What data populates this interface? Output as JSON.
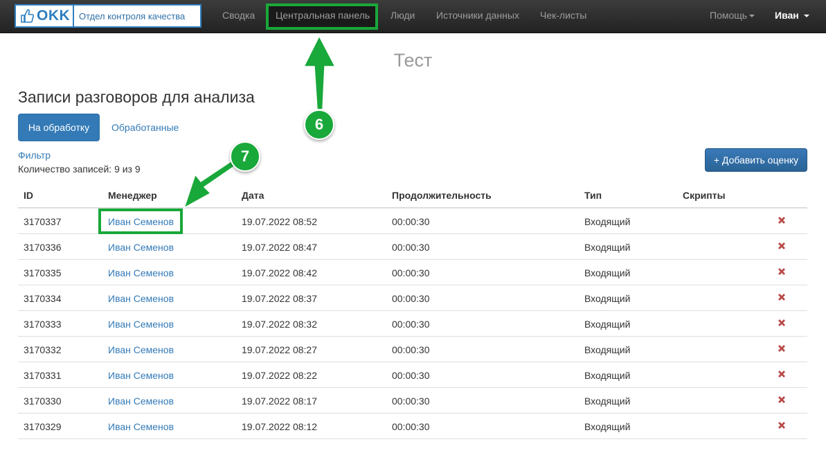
{
  "brand": {
    "logo_text": "OKK",
    "subtitle": "Отдел контроля качества"
  },
  "nav": {
    "items": [
      "Сводка",
      "Центральная панель",
      "Люди",
      "Источники данных",
      "Чек-листы"
    ],
    "help": "Помощь",
    "user": "Иван"
  },
  "page": {
    "title": "Тест",
    "section_title": "Записи разговоров для анализа",
    "tabs": {
      "active": "На обработку",
      "other": "Обработанные"
    },
    "filter": "Фильтр",
    "records_count": "Количество записей: 9 из 9",
    "add_button": "+ Добавить оценку"
  },
  "table": {
    "headers": [
      "ID",
      "Менеджер",
      "Дата",
      "Продолжительность",
      "Тип",
      "Скрипты"
    ],
    "rows": [
      {
        "id": "3170337",
        "manager": "Иван Семенов",
        "date": "19.07.2022 08:52",
        "duration": "00:00:30",
        "type": "Входящий"
      },
      {
        "id": "3170336",
        "manager": "Иван Семенов",
        "date": "19.07.2022 08:47",
        "duration": "00:00:30",
        "type": "Входящий"
      },
      {
        "id": "3170335",
        "manager": "Иван Семенов",
        "date": "19.07.2022 08:42",
        "duration": "00:00:30",
        "type": "Входящий"
      },
      {
        "id": "3170334",
        "manager": "Иван Семенов",
        "date": "19.07.2022 08:37",
        "duration": "00:00:30",
        "type": "Входящий"
      },
      {
        "id": "3170333",
        "manager": "Иван Семенов",
        "date": "19.07.2022 08:32",
        "duration": "00:00:30",
        "type": "Входящий"
      },
      {
        "id": "3170332",
        "manager": "Иван Семенов",
        "date": "19.07.2022 08:27",
        "duration": "00:00:30",
        "type": "Входящий"
      },
      {
        "id": "3170331",
        "manager": "Иван Семенов",
        "date": "19.07.2022 08:22",
        "duration": "00:00:30",
        "type": "Входящий"
      },
      {
        "id": "3170330",
        "manager": "Иван Семенов",
        "date": "19.07.2022 08:17",
        "duration": "00:00:30",
        "type": "Входящий"
      },
      {
        "id": "3170329",
        "manager": "Иван Семенов",
        "date": "19.07.2022 08:12",
        "duration": "00:00:30",
        "type": "Входящий"
      }
    ]
  },
  "annotations": {
    "step_a": "6",
    "step_b": "7"
  },
  "icons": {
    "logo": "thumbs-up-icon",
    "delete": "remove-icon"
  },
  "colors": {
    "primary": "#337ab7",
    "highlight": "#19a83a",
    "danger": "#b94a48",
    "navbar": "#2a2a2a"
  }
}
